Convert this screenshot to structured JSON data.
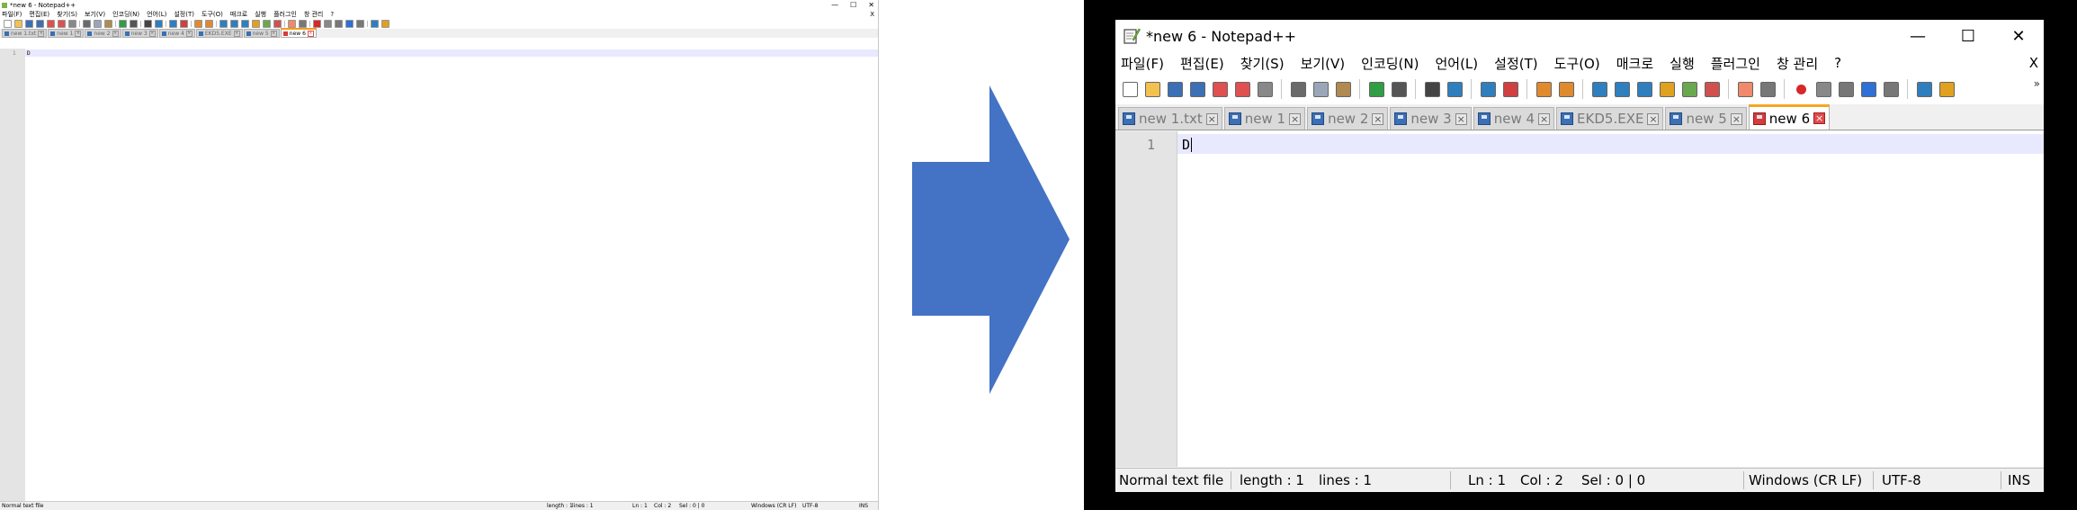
{
  "window": {
    "title": "*new 6 - Notepad++",
    "minimize_glyph": "—",
    "maximize_glyph": "☐",
    "close_glyph": "✕"
  },
  "menu": {
    "items": [
      "파일(F)",
      "편집(E)",
      "찾기(S)",
      "보기(V)",
      "인코딩(N)",
      "언어(L)",
      "설정(T)",
      "도구(O)",
      "매크로",
      "실행",
      "플러그인",
      "창 관리",
      "?"
    ],
    "close_x": "X"
  },
  "toolbar": {
    "icons": [
      "new-file-icon",
      "open-file-icon",
      "save-icon",
      "save-all-icon",
      "close-icon",
      "close-all-icon",
      "print-icon",
      "cut-icon",
      "copy-icon",
      "paste-icon",
      "undo-icon",
      "redo-icon",
      "find-icon",
      "replace-icon",
      "zoom-in-icon",
      "zoom-out-icon",
      "sync-vertical-icon",
      "sync-horizontal-icon",
      "word-wrap-icon",
      "show-all-chars-icon",
      "indent-guide-icon",
      "udl-icon",
      "doc-map-icon",
      "function-list-icon",
      "folder-workspace-icon",
      "monitoring-icon",
      "record-macro-icon",
      "stop-macro-icon",
      "play-macro-icon",
      "run-macro-multiple-icon",
      "save-macro-icon",
      "launch-icon",
      "document-list-icon"
    ],
    "more_glyph": "»"
  },
  "tabs": [
    {
      "label": "new 1.txt",
      "active": false
    },
    {
      "label": "new 1",
      "active": false
    },
    {
      "label": "new 2",
      "active": false
    },
    {
      "label": "new 3",
      "active": false
    },
    {
      "label": "new 4",
      "active": false
    },
    {
      "label": "EKD5.EXE",
      "active": false
    },
    {
      "label": "new 5",
      "active": false
    },
    {
      "label": "new 6",
      "active": true
    }
  ],
  "editor": {
    "line_number": "1",
    "content": "D"
  },
  "status": {
    "file_type": "Normal text file",
    "length": "length : 1",
    "lines": "lines : 1",
    "ln": "Ln : 1",
    "col": "Col : 2",
    "sel": "Sel : 0 | 0",
    "eol": "Windows (CR LF)",
    "encoding": "UTF-8",
    "mode": "INS"
  },
  "colors": {
    "arrow": "#4472c4",
    "active_tab_accent": "#f5a623",
    "current_line": "#e8e8ff",
    "frame": "#000000"
  }
}
